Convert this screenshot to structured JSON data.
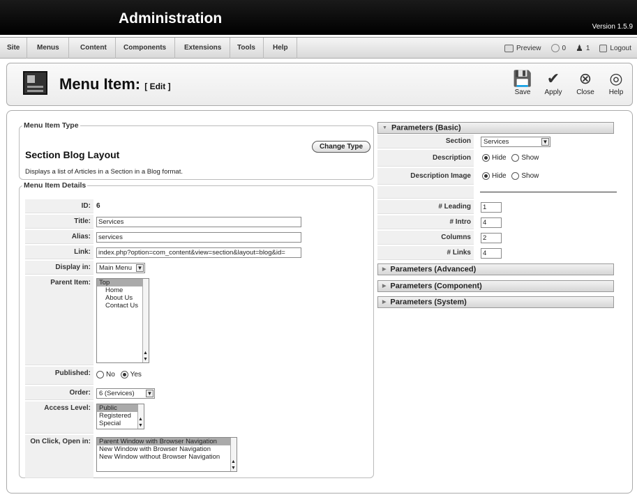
{
  "header": {
    "title": "Administration",
    "version": "Version 1.5.9"
  },
  "menubar": {
    "items": [
      "Site",
      "Menus",
      "Content",
      "Components",
      "Extensions",
      "Tools",
      "Help"
    ],
    "preview": "Preview",
    "messages_count": "0",
    "users_count": "1",
    "logout": "Logout"
  },
  "toolbar": {
    "title": "Menu Item:",
    "subtitle": "[ Edit ]",
    "save": "Save",
    "apply": "Apply",
    "close": "Close",
    "help": "Help"
  },
  "type": {
    "legend": "Menu Item Type",
    "name": "Section Blog Layout",
    "description": "Displays a list of Articles in a Section in a Blog format.",
    "change_button": "Change Type"
  },
  "details": {
    "legend": "Menu Item Details",
    "id_label": "ID:",
    "id_value": "6",
    "title_label": "Title:",
    "title_value": "Services",
    "alias_label": "Alias:",
    "alias_value": "services",
    "link_label": "Link:",
    "link_value": "index.php?option=com_content&view=section&layout=blog&id=",
    "display_label": "Display in:",
    "display_value": "Main Menu",
    "parent_label": "Parent Item:",
    "parent_options": [
      "Top",
      "Home",
      "About Us",
      "Contact Us"
    ],
    "parent_selected": "Top",
    "published_label": "Published:",
    "published_no": "No",
    "published_yes": "Yes",
    "published_value": "Yes",
    "order_label": "Order:",
    "order_value": "6 (Services)",
    "access_label": "Access Level:",
    "access_options": [
      "Public",
      "Registered",
      "Special"
    ],
    "access_selected": "Public",
    "onclick_label": "On Click, Open in:",
    "onclick_options": [
      "Parent Window with Browser Navigation",
      "New Window with Browser Navigation",
      "New Window without Browser Navigation"
    ],
    "onclick_selected": "Parent Window with Browser Navigation"
  },
  "params": {
    "basic_title": "Parameters (Basic)",
    "section_label": "Section",
    "section_value": "Services",
    "description_label": "Description",
    "desc_image_label": "Description Image",
    "hide": "Hide",
    "show": "Show",
    "description_value": "Hide",
    "desc_image_value": "Hide",
    "leading_label": "# Leading",
    "leading_value": "1",
    "intro_label": "# Intro",
    "intro_value": "4",
    "columns_label": "Columns",
    "columns_value": "2",
    "links_label": "# Links",
    "links_value": "4",
    "advanced_title": "Parameters (Advanced)",
    "component_title": "Parameters (Component)",
    "system_title": "Parameters (System)"
  }
}
